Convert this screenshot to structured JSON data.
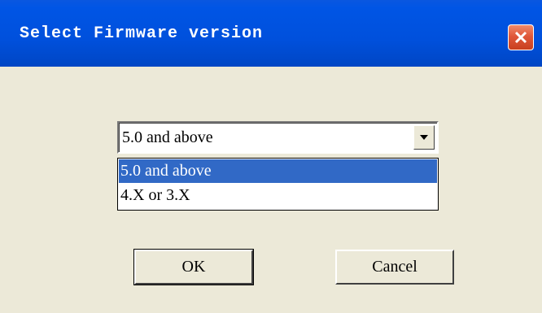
{
  "window": {
    "title": "Select Firmware version",
    "close_icon": "close-icon"
  },
  "firmware_select": {
    "value": "5.0 and above",
    "options": [
      "5.0 and above",
      "4.X or 3.X"
    ],
    "highlighted_index": 0,
    "arrow_icon": "chevron-down-icon"
  },
  "buttons": {
    "ok_label": "OK",
    "cancel_label": "Cancel"
  },
  "colors": {
    "titlebar": "#0050dc",
    "dialog_background": "#ece9d8",
    "selection_highlight": "#3169c6",
    "close_button": "#e0583a"
  }
}
